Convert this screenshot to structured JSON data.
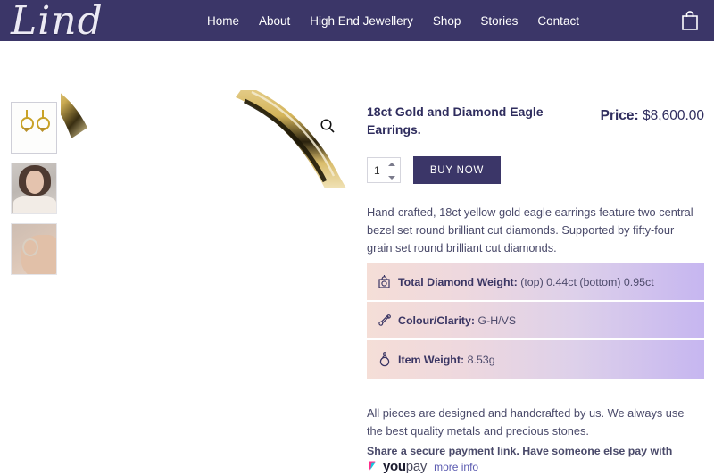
{
  "header": {
    "logo_text": "Lind",
    "nav": [
      {
        "label": "Home"
      },
      {
        "label": "About"
      },
      {
        "label": "High End Jewellery"
      },
      {
        "label": "Shop"
      },
      {
        "label": "Stories"
      },
      {
        "label": "Contact"
      }
    ],
    "cart_icon": "shopping-bag-icon",
    "background_color": "#3b3668"
  },
  "gallery": {
    "zoom_icon": "magnifier-icon",
    "thumbnails": [
      {
        "alt": "Gold hoop eagle earrings on white background",
        "selected": true
      },
      {
        "alt": "Model wearing the earrings, portrait"
      },
      {
        "alt": "Close-up of earring on the ear"
      }
    ],
    "main_image_alt": "Zoomed detail of 18ct gold eagle earring hoop"
  },
  "product": {
    "title": "18ct Gold and Diamond Eagle Earrings.",
    "price_label": "Price:",
    "price_value": "$8,600.00",
    "quantity": "1",
    "buy_button": "BUY NOW",
    "description": "Hand-crafted, 18ct yellow gold eagle earrings feature two central bezel set round brilliant cut diamonds. Supported by fifty-four grain set round brilliant cut diamonds.",
    "specs": [
      {
        "icon": "scale-icon",
        "label": "Total Diamond Weight:",
        "value": "(top) 0.44ct (bottom) 0.95ct"
      },
      {
        "icon": "gem-brush-icon",
        "label": "Colour/Clarity:",
        "value": "G-H/VS"
      },
      {
        "icon": "ring-icon",
        "label": "Item Weight:",
        "value": "8.53g"
      }
    ],
    "footnote": "All pieces are designed and handcrafted by us. We always use the best quality metals and precious stones.",
    "payment": {
      "text": "Share a secure payment link. Have someone else pay with",
      "brand_bold": "you",
      "brand_light": "pay",
      "link": "more info"
    }
  },
  "colors": {
    "brand_navy": "#3b3668",
    "spec_gradient_start": "#f5ded7",
    "spec_gradient_end": "#c6b6f0",
    "gold": "#c9a227",
    "link": "#5a5ab0"
  }
}
